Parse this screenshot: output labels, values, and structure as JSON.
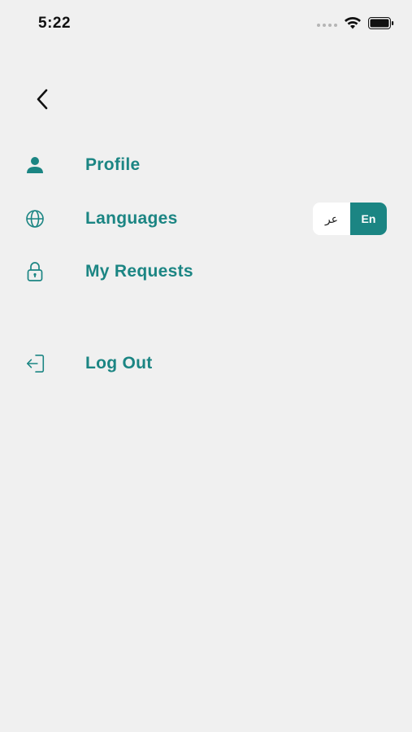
{
  "status_bar": {
    "time": "5:22"
  },
  "colors": {
    "accent": "#1b8583",
    "background": "#f0f0f0"
  },
  "menu": {
    "items": [
      {
        "label": "Profile",
        "icon": "person-icon"
      },
      {
        "label": "Languages",
        "icon": "globe-icon"
      },
      {
        "label": "My Requests",
        "icon": "lock-icon"
      },
      {
        "label": "Log Out",
        "icon": "logout-icon"
      }
    ]
  },
  "language_toggle": {
    "options": [
      "عر",
      "En"
    ],
    "selected": "En"
  }
}
